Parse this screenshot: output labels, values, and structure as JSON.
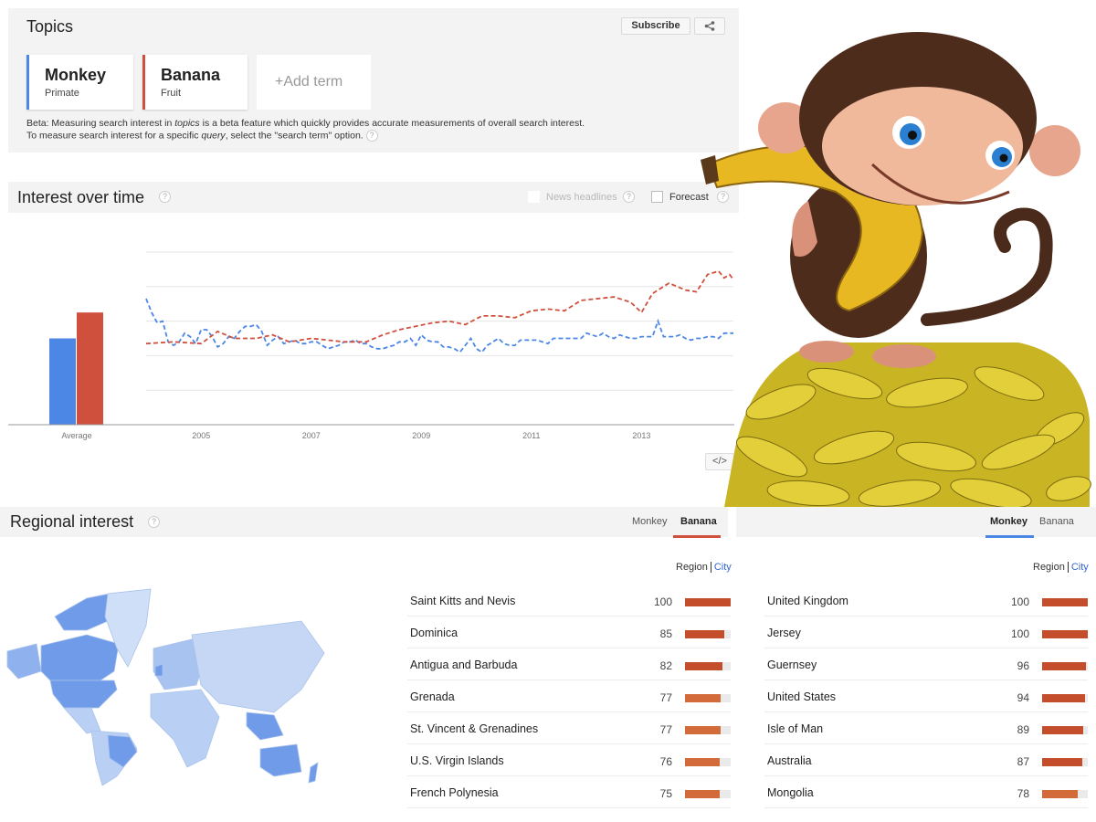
{
  "topics": {
    "title": "Topics",
    "subscribe_label": "Subscribe",
    "share_icon": "share-icon",
    "terms": [
      {
        "name": "Monkey",
        "category": "Primate",
        "color": "#4c87e6"
      },
      {
        "name": "Banana",
        "category": "Fruit",
        "color": "#d0503e"
      }
    ],
    "add_term_label": "+Add term",
    "beta_text_1": "Beta: Measuring search interest in ",
    "beta_italic_1": "topics",
    "beta_text_2": " is a beta feature which quickly provides accurate measurements of overall search interest. To measure search interest for a specific ",
    "beta_italic_2": "query",
    "beta_text_3": ", select the \"search term\" option."
  },
  "interest_over_time": {
    "title": "Interest over time",
    "news_headlines_label": "News headlines",
    "forecast_label": "Forecast",
    "embed_label": "</>",
    "help_glyph": "?"
  },
  "chart_data": {
    "type": "line",
    "title": "Interest over time",
    "xlabel": "",
    "ylabel": "",
    "ylim": [
      0,
      100
    ],
    "xlim": [
      2004.0,
      2014.67
    ],
    "grid": true,
    "x_tick_labels": [
      "2005",
      "2007",
      "2009",
      "2011",
      "2013"
    ],
    "x_ticks": [
      2005,
      2007,
      2009,
      2011,
      2013
    ],
    "average": {
      "label": "Average",
      "series": [
        {
          "name": "Monkey",
          "value": 50,
          "color": "#4c87e6"
        },
        {
          "name": "Banana",
          "value": 65,
          "color": "#d0503e"
        }
      ]
    },
    "series": [
      {
        "name": "Monkey",
        "color": "#4c87e6",
        "style": "dashed",
        "x": [
          2004.0,
          2004.1,
          2004.2,
          2004.3,
          2004.4,
          2004.5,
          2004.6,
          2004.7,
          2004.8,
          2004.9,
          2005.0,
          2005.1,
          2005.2,
          2005.3,
          2005.4,
          2005.5,
          2005.6,
          2005.7,
          2005.8,
          2005.9,
          2006.0,
          2006.1,
          2006.2,
          2006.3,
          2006.4,
          2006.5,
          2006.6,
          2006.7,
          2006.8,
          2006.9,
          2007.0,
          2007.1,
          2007.2,
          2007.3,
          2007.4,
          2007.5,
          2007.6,
          2007.7,
          2007.8,
          2007.9,
          2008.0,
          2008.1,
          2008.2,
          2008.3,
          2008.4,
          2008.5,
          2008.6,
          2008.7,
          2008.8,
          2008.9,
          2009.0,
          2009.1,
          2009.2,
          2009.3,
          2009.4,
          2009.5,
          2009.6,
          2009.7,
          2009.8,
          2009.9,
          2010.0,
          2010.1,
          2010.2,
          2010.3,
          2010.4,
          2010.5,
          2010.6,
          2010.7,
          2010.8,
          2010.9,
          2011.0,
          2011.1,
          2011.2,
          2011.3,
          2011.4,
          2011.5,
          2011.6,
          2011.7,
          2011.8,
          2011.9,
          2012.0,
          2012.1,
          2012.2,
          2012.3,
          2012.4,
          2012.5,
          2012.6,
          2012.7,
          2012.8,
          2012.9,
          2013.0,
          2013.1,
          2013.2,
          2013.3,
          2013.4,
          2013.5,
          2013.6,
          2013.7,
          2013.8,
          2013.9,
          2014.0,
          2014.1,
          2014.2,
          2014.3,
          2014.4,
          2014.5,
          2014.6,
          2014.67
        ],
        "values": [
          73,
          65,
          59,
          60,
          48,
          46,
          48,
          53,
          51,
          47,
          55,
          55,
          51,
          45,
          47,
          51,
          50,
          54,
          57,
          57,
          58,
          54,
          46,
          49,
          51,
          47,
          48,
          49,
          47,
          47,
          48,
          48,
          46,
          44,
          45,
          46,
          48,
          48,
          49,
          47,
          47,
          45,
          44,
          44,
          45,
          46,
          48,
          48,
          50,
          46,
          52,
          49,
          48,
          48,
          45,
          45,
          44,
          42,
          46,
          50,
          44,
          42,
          46,
          48,
          50,
          47,
          46,
          46,
          49,
          49,
          49,
          49,
          48,
          47,
          50,
          50,
          50,
          50,
          50,
          50,
          53,
          52,
          51,
          53,
          51,
          50,
          52,
          51,
          50,
          50,
          51,
          51,
          51,
          60,
          51,
          51,
          51,
          52,
          50,
          49,
          50,
          50,
          51,
          51,
          50,
          53,
          53,
          53,
          50,
          52,
          54,
          51
        ],
        "note": "values estimated from gridlines (0-100 scale)"
      },
      {
        "name": "Banana",
        "color": "#d0503e",
        "style": "dashed",
        "x": [
          2004.0,
          2004.5,
          2005.0,
          2005.3,
          2005.6,
          2006.0,
          2006.3,
          2006.6,
          2007.0,
          2007.3,
          2007.6,
          2008.0,
          2008.3,
          2008.6,
          2008.9,
          2009.2,
          2009.5,
          2009.8,
          2010.1,
          2010.4,
          2010.7,
          2011.0,
          2011.3,
          2011.6,
          2011.9,
          2012.2,
          2012.5,
          2012.8,
          2013.0,
          2013.2,
          2013.5,
          2013.8,
          2014.0,
          2014.2,
          2014.4,
          2014.5,
          2014.6,
          2014.67
        ],
        "values": [
          47,
          48,
          47,
          54,
          50,
          50,
          52,
          48,
          50,
          49,
          48,
          48,
          52,
          55,
          57,
          59,
          60,
          58,
          63,
          63,
          62,
          66,
          67,
          66,
          72,
          73,
          74,
          71,
          65,
          76,
          82,
          78,
          77,
          87,
          89,
          85,
          87,
          84
        ],
        "note": "values estimated from gridlines (0-100 scale)"
      }
    ]
  },
  "regional_interest": {
    "title": "Regional interest",
    "tabs_banana_panel": [
      {
        "label": "Monkey",
        "active": false
      },
      {
        "label": "Banana",
        "active": true
      }
    ],
    "tabs_monkey_panel": [
      {
        "label": "Monkey",
        "active": true
      },
      {
        "label": "Banana",
        "active": false
      }
    ],
    "region_label": "Region",
    "city_label": "City",
    "banana_list": [
      {
        "name": "Saint Kitts and Nevis",
        "value": 100
      },
      {
        "name": "Dominica",
        "value": 85
      },
      {
        "name": "Antigua and Barbuda",
        "value": 82
      },
      {
        "name": "Grenada",
        "value": 77
      },
      {
        "name": "St. Vincent & Grenadines",
        "value": 77
      },
      {
        "name": "U.S. Virgin Islands",
        "value": 76
      },
      {
        "name": "French Polynesia",
        "value": 75
      }
    ],
    "monkey_list": [
      {
        "name": "United Kingdom",
        "value": 100
      },
      {
        "name": "Jersey",
        "value": 100
      },
      {
        "name": "Guernsey",
        "value": 96
      },
      {
        "name": "United States",
        "value": 94
      },
      {
        "name": "Isle of Man",
        "value": 89
      },
      {
        "name": "Australia",
        "value": 87
      },
      {
        "name": "Mongolia",
        "value": 78
      }
    ],
    "map_icon": "world-map"
  },
  "colors": {
    "monkey": "#4c87e6",
    "banana": "#d0503e",
    "bar_high": "#c44d2b",
    "bar_low": "#d36a3a"
  },
  "overlay": {
    "image": "cartoon-monkey-holding-banana-on-banana-pile"
  }
}
